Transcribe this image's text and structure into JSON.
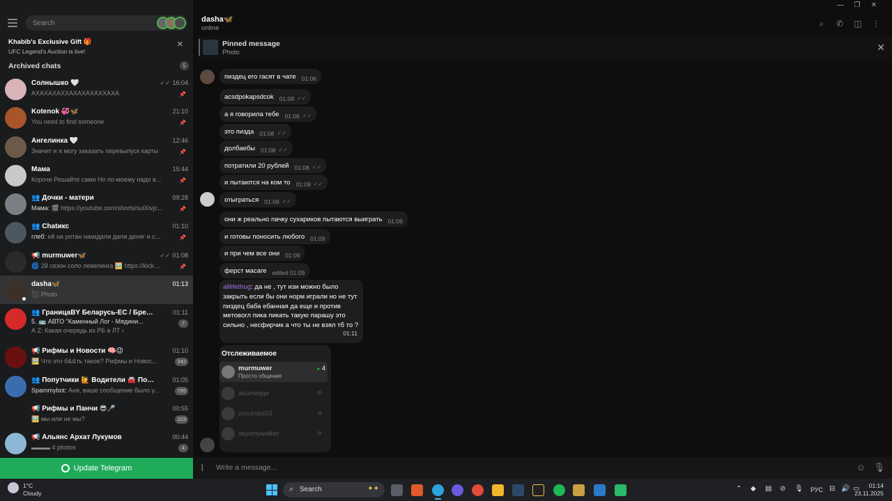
{
  "window": {
    "minimize": "—",
    "maximize": "❐",
    "close": "✕"
  },
  "sidebar": {
    "search_placeholder": "Search",
    "promo": {
      "title": "Khabib's Exclusive Gift 🎁",
      "subtitle": "UFC Legend's Auction is live!"
    },
    "archived": {
      "label": "Archived chats",
      "count": "5"
    },
    "chats": [
      {
        "name": "Солнышко 🤍",
        "time": "16:04",
        "preview": "АХАХАХАХХАХАХАХАХХАХА",
        "check": true,
        "pinned": true,
        "color": "#d8b3b8"
      },
      {
        "name": "Kotenok 💞🦋",
        "time": "21:10",
        "preview": "You need to find someone",
        "pinned": true,
        "color": "#a8552a"
      },
      {
        "name": "Ангелинка 🤍",
        "time": "12:46",
        "preview": "Значит и я могу заказать перевыпуск карты",
        "pinned": true,
        "color": "#6d5a48"
      },
      {
        "name": "Мама",
        "time": "15:44",
        "preview": "Короче Решайте сами  Но по-моему надо в...",
        "pinned": true,
        "color": "#c8c8c8"
      },
      {
        "name": "👥 Дочки - матери",
        "time": "09:28",
        "sender": "Мама:",
        "preview": "🎬 https://youtube.com/shorts/sulXivjc...",
        "pinned": true,
        "color": "#7a7f86"
      },
      {
        "name": "👥 Chatикс",
        "time": "01:10",
        "sender": "глеб:",
        "preview": "ей на ротан накидали дали деняг и с...",
        "pinned": true,
        "color": "#4d5560"
      },
      {
        "name": "📢 murmuwer🦋",
        "time": "01:08",
        "preview": "🌀 2й сезон соло левелинга 🖼️ https://kick....",
        "check": true,
        "pinned": true,
        "color": "#2b2b2b"
      },
      {
        "name": "dasha🦋",
        "time": "01:13",
        "preview": "⬛ Photo",
        "active": true,
        "online": true,
        "color": "#3d3028"
      },
      {
        "name": "👥 ГраницаBY Беларусь-ЕС / Брест -...",
        "time": "01:11",
        "sender": "5. 🚌 АВТО \"Каменный Лог - Мядини...",
        "preview": "А Z: Какая очередь из РБ в ЛТ ›",
        "badge": "7",
        "color": "#d62a2a"
      },
      {
        "name": "📢 Рифмы и Новости 🧠😉",
        "time": "01:10",
        "preview": "🖼️ Что это б&&ть такое? Рифмы и Новос...",
        "badge": "242",
        "color": "#6b1010"
      },
      {
        "name": "👥 Попутчики 🙋 Водители 🚘 Посы...",
        "time": "01:05",
        "sender": "Spammybot:",
        "preview": "Аня, ваше сообщение было у...",
        "badge": "795",
        "color": "#3a6cb0"
      },
      {
        "name": "📢 Рифмы и Панчи 😎🎤",
        "time": "00:55",
        "preview": "🖼️ мы или не мы?",
        "badge": "223",
        "color": "#1a1a1a"
      },
      {
        "name": "📢 Альянс Архат Лукумов",
        "time": "00:44",
        "preview": "▬▬▬ 4 photos",
        "badge": "4",
        "color": "#8cb8d6"
      }
    ],
    "update_button": "Update Telegram"
  },
  "header": {
    "name": "dasha🦋",
    "status": "online"
  },
  "pinned": {
    "title": "Pinned message",
    "subtitle": "Photo"
  },
  "messages": [
    {
      "text": "пиздец его гасят в чате",
      "time": "01:08"
    },
    {
      "text": "acsdpokapsdcok",
      "time": "01:08",
      "check": "✓✓"
    },
    {
      "text": "а я говорила тебе",
      "time": "01:08",
      "check": "✓✓"
    },
    {
      "text": "это пизда",
      "time": "01:08",
      "check": "✓✓"
    },
    {
      "text": "долбаебы",
      "time": "01:08",
      "check": "✓✓"
    },
    {
      "text": "потратили 20 рублей",
      "time": "01:08",
      "check": "✓✓"
    },
    {
      "text": "и пытаются на ком то",
      "time": "01:09",
      "check": "✓✓"
    },
    {
      "text": "отыграться",
      "time": "01:09",
      "check": "✓✓"
    },
    {
      "text": "они ж реально пачку сухариков пытаются выиграть",
      "time": "01:09"
    },
    {
      "text": "и готовы поносить любого",
      "time": "01:09"
    },
    {
      "text": "и при чем все они",
      "time": "01:09"
    },
    {
      "text": "ферст масаге",
      "time": "edited 01:09"
    }
  ],
  "big_message": {
    "author": "alllifethug",
    "text": ": да не , тут изи можно было закрыть если бы они норм играли но не тут пиздец баба ебанная да еще и против метовогл пика пикать такую парашу это сильно , несфирчик а что ты не взял тб то ?",
    "time": "01:11"
  },
  "tracked": {
    "title": "Отслеживаемое",
    "items": [
      {
        "name": "murmuwer",
        "sub": "Просто общение",
        "count": "4"
      },
      {
        "name": "akumaqqe"
      },
      {
        "name": "zxcursed33"
      },
      {
        "name": "skywhywalker"
      }
    ]
  },
  "composer": {
    "placeholder": "Write a message..."
  },
  "taskbar": {
    "temp": "1°C",
    "weather": "Cloudy",
    "search": "Search",
    "lang": "РУС",
    "time": "01:14",
    "date": "23.11.2025"
  }
}
